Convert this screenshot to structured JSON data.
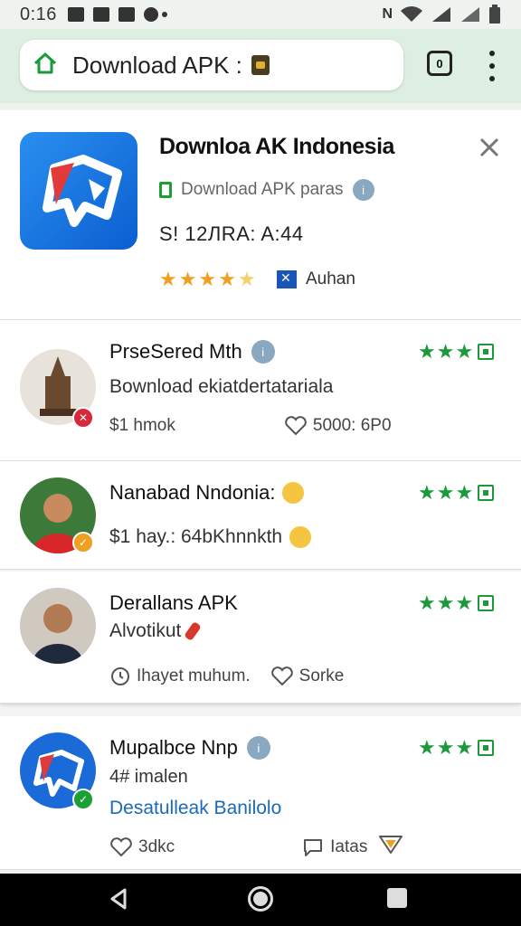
{
  "status": {
    "time": "0:16"
  },
  "browser": {
    "url_text": "Download APK :"
  },
  "app": {
    "title": "Downloa AK Indonesia",
    "developer": "Download APK paras",
    "meta": "S! 12ЛRA: A:44",
    "rating_stars": 5,
    "author": "Auhan"
  },
  "reviews": [
    {
      "name": "PrseSered Mth",
      "text": "Bownload ekiatdertatariala",
      "date": "$1 hmok",
      "likes": "5000: 6P0",
      "stars": 3
    },
    {
      "name": "Nanabad Nndonia:",
      "text": "$1 hay.: 64bKhnnkth",
      "stars": 3
    },
    {
      "name": "Derallans APK",
      "text": "Alvotikut",
      "date": "Ihayet muhum.",
      "likes": "Sorke",
      "stars": 3
    },
    {
      "name": "Mupalbce Nnp",
      "text": "4# imalen",
      "link": "Desatulleak Banilolo",
      "likes": "3dkc",
      "comments": "Iatas",
      "stars": 3
    }
  ],
  "colors": {
    "accent_green": "#1a9a3a",
    "link_blue": "#1a6ab8",
    "chrome_bg": "#dcefe2",
    "star_gold": "#f0a020"
  }
}
